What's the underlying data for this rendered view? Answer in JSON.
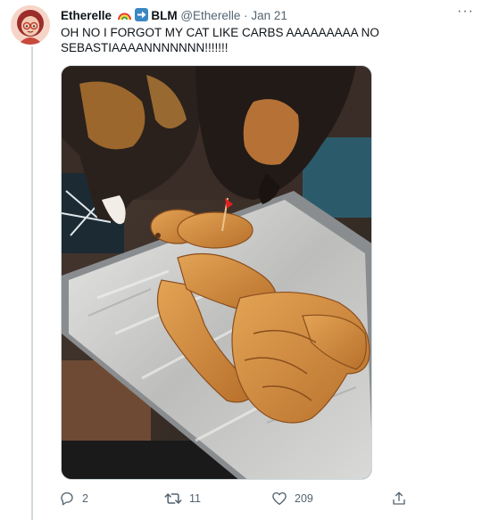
{
  "tweet": {
    "author_name": "Etherelle",
    "author_suffix": "BLM",
    "handle": "@Etherelle",
    "separator": "·",
    "date": "Jan 21",
    "more": "···",
    "text": "OH NO I FORGOT MY CAT LIKE CARBS AAAAAAAAA NO SEBASTIAAAANNNNNNN!!!!!!!",
    "actions": {
      "replies": "2",
      "retweets": "11",
      "likes": "209"
    }
  },
  "icons": {
    "name_emoji_1": "rainbow-icon",
    "name_emoji_2": "right-arrow-icon",
    "reply": "reply-icon",
    "retweet": "retweet-icon",
    "like": "heart-icon",
    "share": "share-icon"
  },
  "colors": {
    "text": "#0f1419",
    "secondary": "#536471",
    "thread_line": "#cfd9de",
    "arrow_emoji_bg": "#3b88c3"
  }
}
